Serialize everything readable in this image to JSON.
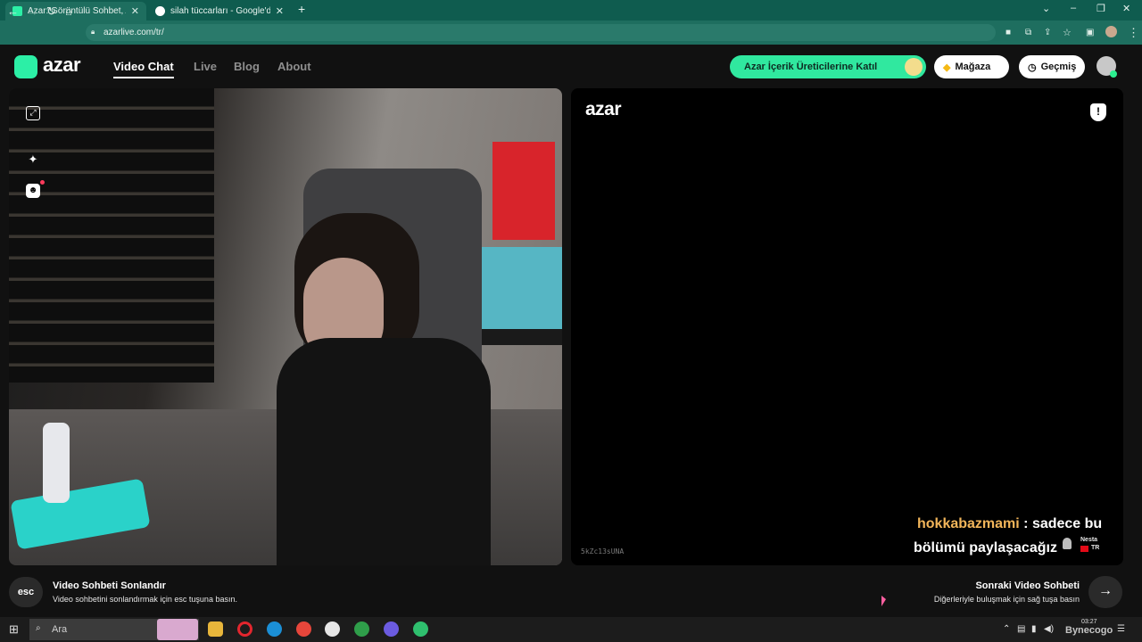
{
  "browser": {
    "tabs": [
      {
        "title": "Azar: Görüntülü Sohbet, Arkadaş",
        "active": true
      },
      {
        "title": "silah tüccarları - Google'da Ara",
        "active": false
      }
    ],
    "new_tab_symbol": "+",
    "url": "azarlive.com/tr/"
  },
  "site": {
    "logo_text": "azar",
    "nav": [
      "Video Chat",
      "Live",
      "Blog",
      "About"
    ],
    "active_nav": "Video Chat",
    "creators_button": "Azar İçerik Üreticilerine Katıl",
    "shop_button": "Mağaza",
    "history_button": "Geçmiş",
    "accent_color": "#30e89f"
  },
  "right_panel": {
    "logo_text": "azar",
    "session_code": "5kZc13sUNA",
    "caption": {
      "username": "hokkabazmami",
      "separator": " : ",
      "line1": "sadece bu",
      "line2": "bölümü paylaşacağız"
    },
    "peer": {
      "name": "Nesta",
      "country": "TR"
    }
  },
  "bottom_bar": {
    "esc_key": "esc",
    "end_title": "Video Sohbeti Sonlandır",
    "end_sub": "Video sohbetini sonlandırmak için esc tuşuna basın.",
    "next_title": "Sonraki Video Sohbeti",
    "next_sub": "Diğerleriyle buluşmak için sağ tuşa basın"
  },
  "taskbar": {
    "search_placeholder": "Ara",
    "time": "03:27",
    "watermark": "Bynecogo"
  }
}
